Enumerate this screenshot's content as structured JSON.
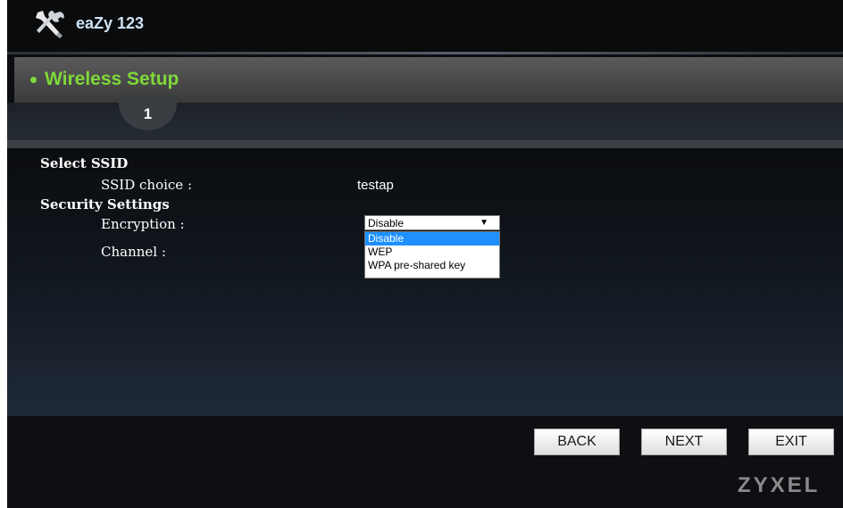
{
  "app": {
    "title": "eaZy 123",
    "logo_icon": "tools-icon",
    "brand": "ZYXEL"
  },
  "page": {
    "title": "Wireless Setup",
    "step": "1",
    "accent_color": "#7fd83a"
  },
  "sections": {
    "ssid": {
      "heading": "Select SSID",
      "ssid_choice_label": "SSID choice :",
      "ssid_choice_value": "testap"
    },
    "security": {
      "heading": "Security Settings",
      "encryption_label": "Encryption :",
      "channel_label": "Channel :",
      "encryption_selected": "Disable",
      "encryption_options": [
        "Disable",
        "WEP",
        "WPA pre-shared key"
      ]
    }
  },
  "buttons": {
    "back": "BACK",
    "next": "NEXT",
    "exit": "EXIT"
  }
}
